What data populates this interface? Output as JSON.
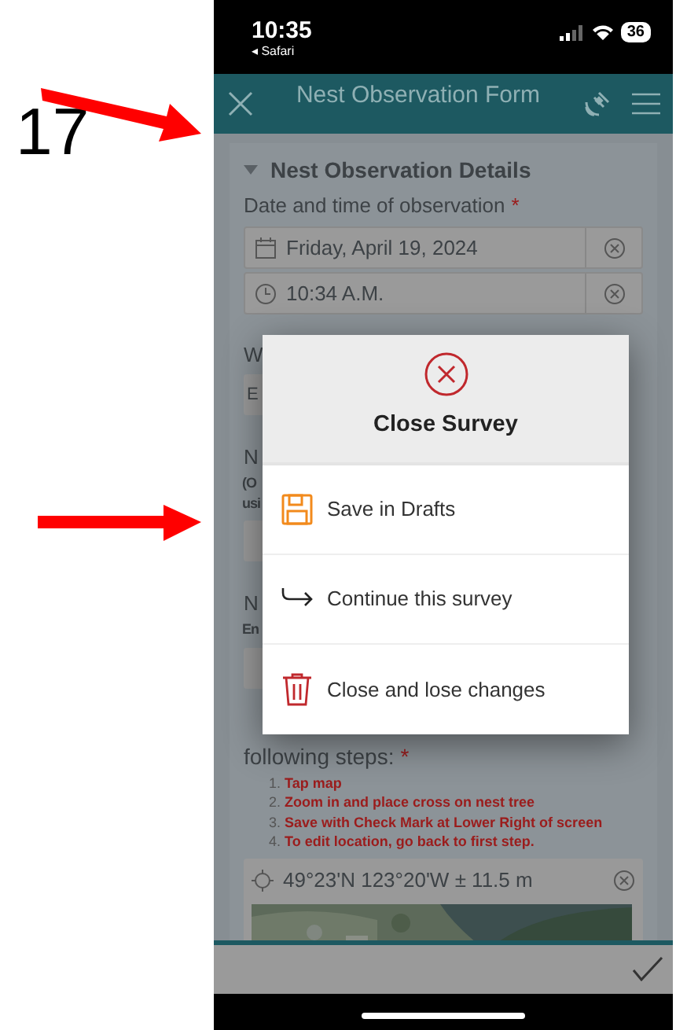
{
  "annotation": {
    "number": "17"
  },
  "status_bar": {
    "time": "10:35",
    "back_app": "◂ Safari",
    "battery": "36"
  },
  "header": {
    "title": "Nest Observation Form"
  },
  "form": {
    "section": {
      "title": "Nest Observation Details",
      "expanded": true
    },
    "date_label": {
      "text": "Date and time of observation",
      "required_mark": "*"
    },
    "date_field": {
      "value": "Friday, April 19, 2024"
    },
    "time_field": {
      "value": "10:34 A.M."
    },
    "partial_rows": [
      {
        "kind": "label",
        "text": "W"
      },
      {
        "kind": "field",
        "text": "E"
      },
      {
        "kind": "label",
        "text": "N"
      },
      {
        "kind": "hint",
        "text": "(O"
      },
      {
        "kind": "hint",
        "text": "usi"
      },
      {
        "kind": "field"
      },
      {
        "kind": "label",
        "text": "N"
      },
      {
        "kind": "hint",
        "text": "En"
      },
      {
        "kind": "field"
      }
    ],
    "steps_label": {
      "text": "following steps:",
      "required_mark": "*"
    },
    "steps": [
      {
        "number": "1.",
        "text": "Tap map"
      },
      {
        "number": "2.",
        "text": "Zoom in and place cross on nest tree"
      },
      {
        "number": "3.",
        "text": "Save with Check Mark at Lower Right of screen"
      },
      {
        "number": "4.",
        "text": "To edit location, go back to first step."
      }
    ],
    "location_field": {
      "value": "49°23'N 123°20'W ± 11.5 m"
    }
  },
  "modal": {
    "title": "Close Survey",
    "options": [
      {
        "kind": "save",
        "label": "Save in Drafts"
      },
      {
        "kind": "continue",
        "label": "Continue this survey"
      },
      {
        "kind": "discard",
        "label": "Close and lose changes"
      }
    ]
  }
}
